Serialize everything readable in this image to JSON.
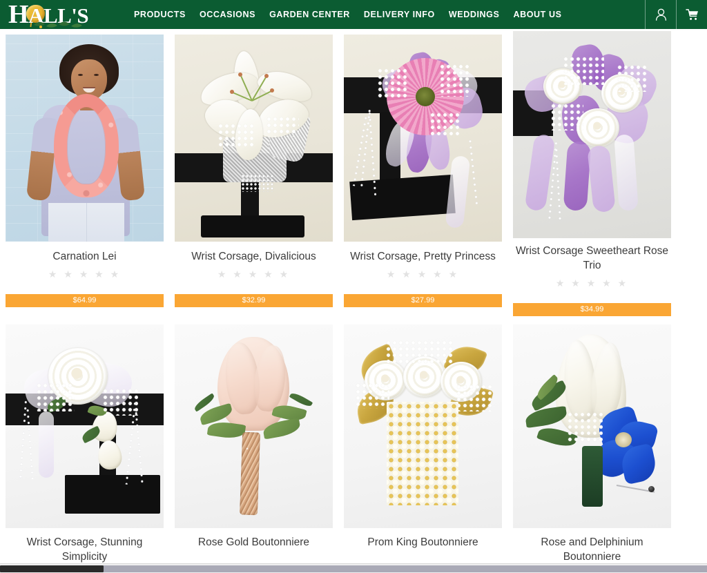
{
  "header": {
    "brand": "HALL'S",
    "brand_h": "H",
    "brand_rest": "ALL'S",
    "green": "#0b5c32",
    "nav": [
      {
        "label": "PRODUCTS"
      },
      {
        "label": "OCCASIONS"
      },
      {
        "label": "GARDEN CENTER"
      },
      {
        "label": "DELIVERY INFO"
      },
      {
        "label": "WEDDINGS"
      },
      {
        "label": "ABOUT US"
      }
    ],
    "account_icon": "user-account-icon",
    "cart_icon": "shopping-cart-icon"
  },
  "grid": {
    "price_bar_color": "#faa634",
    "star_color": "#e2e2e2",
    "rating_stars": "★ ★ ★ ★ ★",
    "rows": [
      {
        "products": [
          {
            "title": "Carnation Lei",
            "price": "$64.99",
            "rating": 0
          },
          {
            "title": "Wrist Corsage, Divalicious",
            "price": "$32.99",
            "rating": 0
          },
          {
            "title": "Wrist Corsage, Pretty Princess",
            "price": "$27.99",
            "rating": 0
          },
          {
            "title": "Wrist Corsage Sweetheart Rose Trio",
            "price": "$34.99",
            "rating": 0
          }
        ]
      },
      {
        "products": [
          {
            "title": "Wrist Corsage, Stunning Simplicity",
            "price": "",
            "rating": 0
          },
          {
            "title": "Rose Gold Boutonniere",
            "price": "",
            "rating": 0
          },
          {
            "title": "Prom King Boutonniere",
            "price": "",
            "rating": 0
          },
          {
            "title": "Rose and Delphinium Boutonniere",
            "price": "",
            "rating": 0
          }
        ]
      }
    ]
  }
}
